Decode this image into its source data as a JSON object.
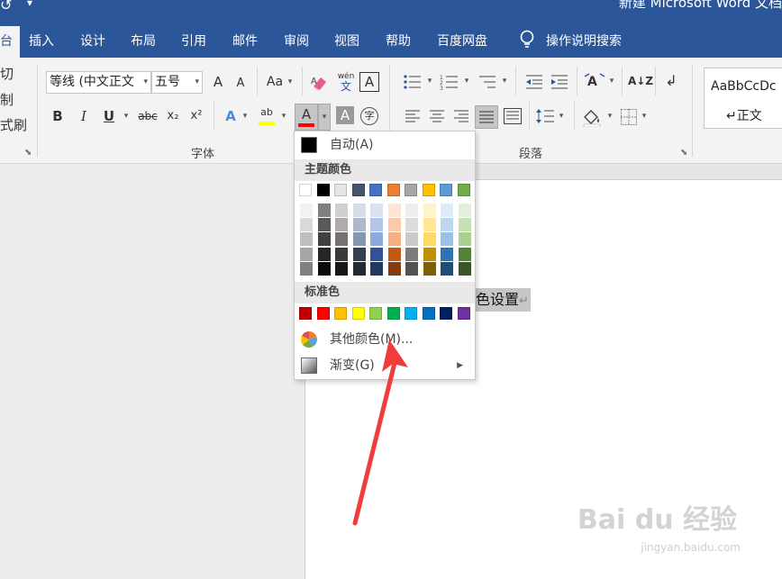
{
  "window": {
    "title": "新建 Microsoft Word 文档"
  },
  "ribbon_tabs": {
    "home": "台",
    "insert": "插入",
    "design": "设计",
    "layout": "布局",
    "references": "引用",
    "mailings": "邮件",
    "review": "审阅",
    "view": "视图",
    "help": "帮助",
    "baidu_netdisk": "百度网盘",
    "tell_me": "操作说明搜索"
  },
  "clipboard": {
    "cut": "切",
    "copy": "制",
    "format_painter": "式刷"
  },
  "font_group": {
    "label": "字体",
    "font_name": "等线 (中文正文",
    "font_size": "五号",
    "grow": "A",
    "shrink": "A",
    "change_case": "Aa",
    "phonetic_top": "wén",
    "phonetic_bottom": "文",
    "char_border": "A",
    "bold": "B",
    "italic": "I",
    "underline": "U",
    "strikethrough": "abc",
    "subscript": "x₂",
    "superscript": "x²",
    "text_effects": "A",
    "highlight": "ab",
    "font_color": "A",
    "char_shading": "A",
    "enclose": "字"
  },
  "paragraph_group": {
    "label": "段落",
    "sort": "A↓Z"
  },
  "styles": {
    "preview": "AaBbCcDc",
    "normal": "正文"
  },
  "color_menu": {
    "auto_label": "自动(A)",
    "theme_header": "主题颜色",
    "standard_header": "标准色",
    "more_colors": "其他颜色(M)...",
    "gradient": "渐变(G)",
    "theme_colors": [
      "#FFFFFF",
      "#000000",
      "#E7E6E6",
      "#44546A",
      "#4472C4",
      "#ED7D31",
      "#A5A5A5",
      "#FFC000",
      "#5B9BD5",
      "#70AD47"
    ],
    "theme_shades": [
      [
        "#F2F2F2",
        "#D9D9D9",
        "#BFBFBF",
        "#A6A6A6",
        "#808080"
      ],
      [
        "#7F7F7F",
        "#595959",
        "#404040",
        "#262626",
        "#0D0D0D"
      ],
      [
        "#D0CECE",
        "#AFABAB",
        "#757171",
        "#3A3838",
        "#171616"
      ],
      [
        "#D6DCE4",
        "#ADB9CA",
        "#8497B0",
        "#333F50",
        "#222B35"
      ],
      [
        "#D9E1F2",
        "#B4C6E7",
        "#8EA9DB",
        "#2F5496",
        "#1F3864"
      ],
      [
        "#FCE4D6",
        "#F8CBAD",
        "#F4B084",
        "#C65911",
        "#833C0B"
      ],
      [
        "#EDEDED",
        "#DBDBDB",
        "#C9C9C9",
        "#7B7B7B",
        "#525252"
      ],
      [
        "#FFF2CC",
        "#FFE699",
        "#FFD966",
        "#BF8F00",
        "#7F6000"
      ],
      [
        "#DDEBF7",
        "#BDD7EE",
        "#9BC2E6",
        "#2F75B5",
        "#1F4E78"
      ],
      [
        "#E2EFDA",
        "#C6E0B4",
        "#A9D08E",
        "#548235",
        "#375623"
      ]
    ],
    "standard_colors": [
      "#C00000",
      "#FF0000",
      "#FFC000",
      "#FFFF00",
      "#92D050",
      "#00B050",
      "#00B0F0",
      "#0070C0",
      "#002060",
      "#7030A0"
    ]
  },
  "document": {
    "selected_text": "颜色设置",
    "pilcrow": "↵"
  },
  "watermark": {
    "brand": "Bai du 经验",
    "url": "jingyan.baidu.com"
  },
  "colors": {
    "accent": "#2b579a",
    "font_color_bar": "#FF0000",
    "highlight_bar": "#FFFF00",
    "arrow": "#F03C3C"
  }
}
